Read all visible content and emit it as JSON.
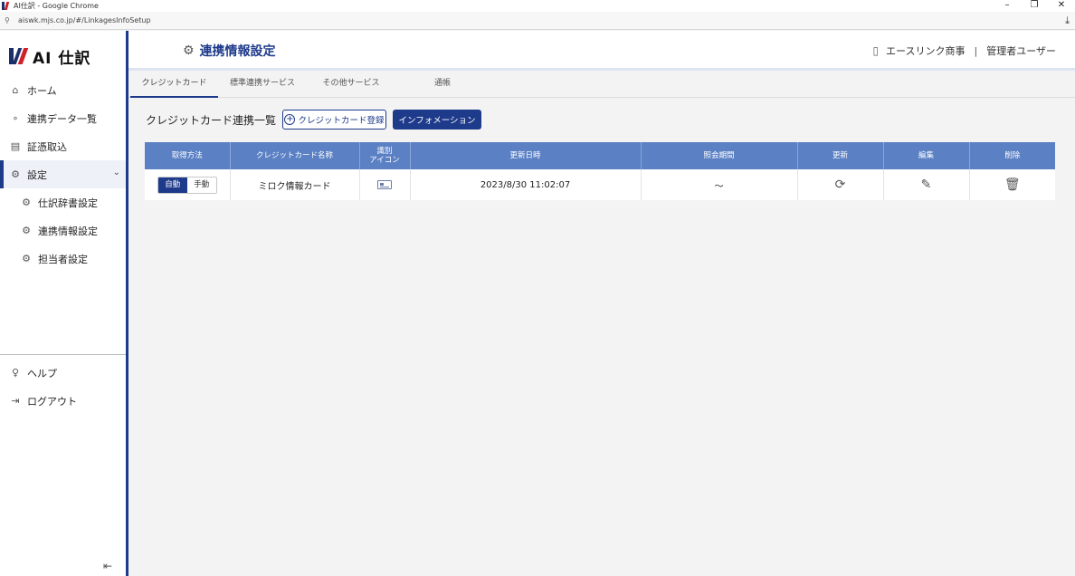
{
  "browser": {
    "window_title": "AI仕訳 - Google Chrome",
    "url": "aiswk.mjs.co.jp/#/LinkagesInfoSetup",
    "minimize_glyph": "–",
    "restore_glyph": "❐",
    "close_glyph": "✕"
  },
  "sidebar": {
    "brand_name": "AI 仕訳",
    "items": [
      {
        "label": "ホーム"
      },
      {
        "label": "連携データ一覧"
      },
      {
        "label": "証憑取込"
      },
      {
        "label": "設定"
      }
    ],
    "sub_items": [
      {
        "label": "仕訳辞書設定"
      },
      {
        "label": "連携情報設定"
      },
      {
        "label": "担当者設定"
      }
    ],
    "bottom_items": [
      {
        "label": "ヘルプ"
      },
      {
        "label": "ログアウト"
      }
    ]
  },
  "header": {
    "title": "連携情報設定",
    "company": "エースリンク商事",
    "separator": "|",
    "user": "管理者ユーザー"
  },
  "tabs": [
    {
      "label": "クレジットカード"
    },
    {
      "label": "標準連携サービス"
    },
    {
      "label": "その他サービス"
    },
    {
      "label": "通帳"
    }
  ],
  "section": {
    "title": "クレジットカード連携一覧",
    "register_button": "クレジットカード登録",
    "info_button": "インフォメーション"
  },
  "table": {
    "headers": [
      "取得方法",
      "クレジットカード名称",
      "識別\nアイコン",
      "更新日時",
      "照会期間",
      "更新",
      "編集",
      "削除"
    ],
    "header_icon_line1": "識別",
    "header_icon_line2": "アイコン",
    "rows": [
      {
        "mode_auto": "自動",
        "mode_manual": "手動",
        "name": "ミロク情報カード",
        "updated": "2023/8/30 11:02:07",
        "period": "～"
      }
    ]
  },
  "colors": {
    "accent": "#1e3a8a",
    "table_header": "#5b80c4"
  }
}
